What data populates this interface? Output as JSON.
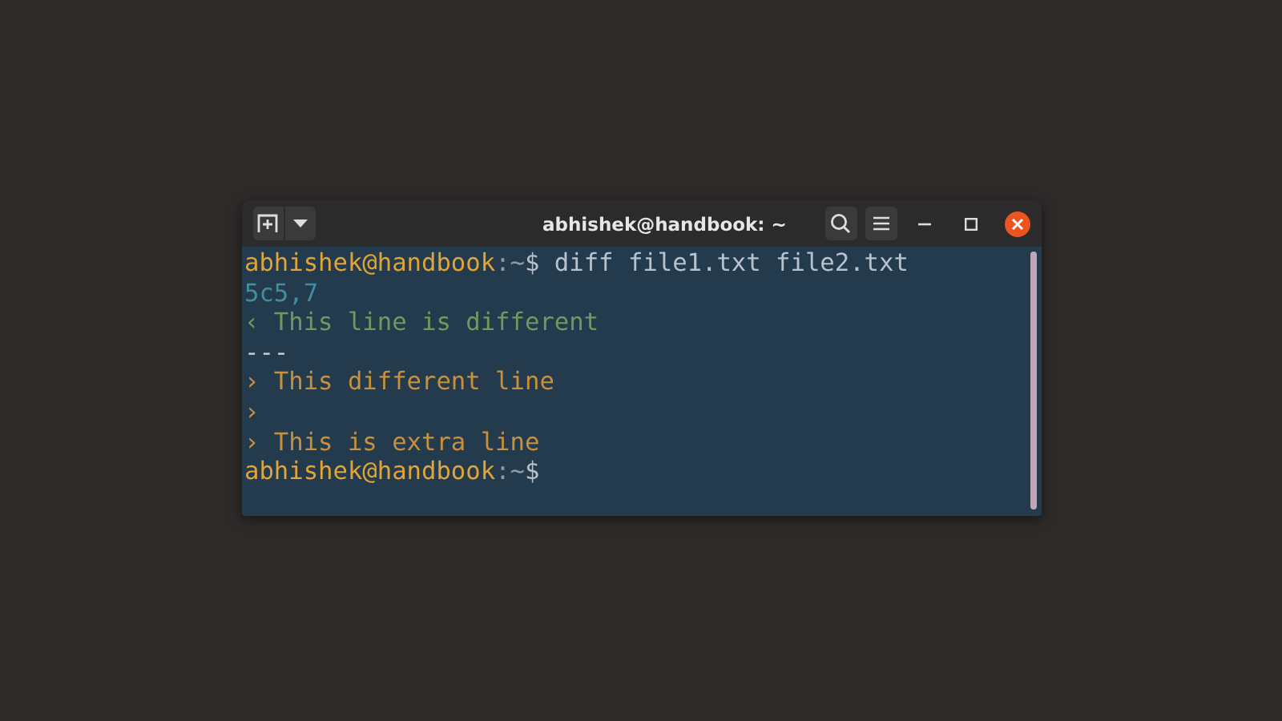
{
  "window": {
    "title": "abhishek@handbook: ~"
  },
  "terminal": {
    "lines": [
      {
        "kind": "prompt",
        "user": "abhishek@handbook",
        "path": ":~",
        "symbol": "$",
        "command": " diff file1.txt file2.txt"
      },
      {
        "kind": "hunk",
        "text": "5c5,7"
      },
      {
        "kind": "removed",
        "text": "‹ This line is different"
      },
      {
        "kind": "separator",
        "text": "---"
      },
      {
        "kind": "added",
        "text": "› This different line"
      },
      {
        "kind": "added",
        "text": "›"
      },
      {
        "kind": "added",
        "text": "› This is extra line"
      },
      {
        "kind": "prompt",
        "user": "abhishek@handbook",
        "path": ":~",
        "symbol": "$"
      }
    ]
  }
}
